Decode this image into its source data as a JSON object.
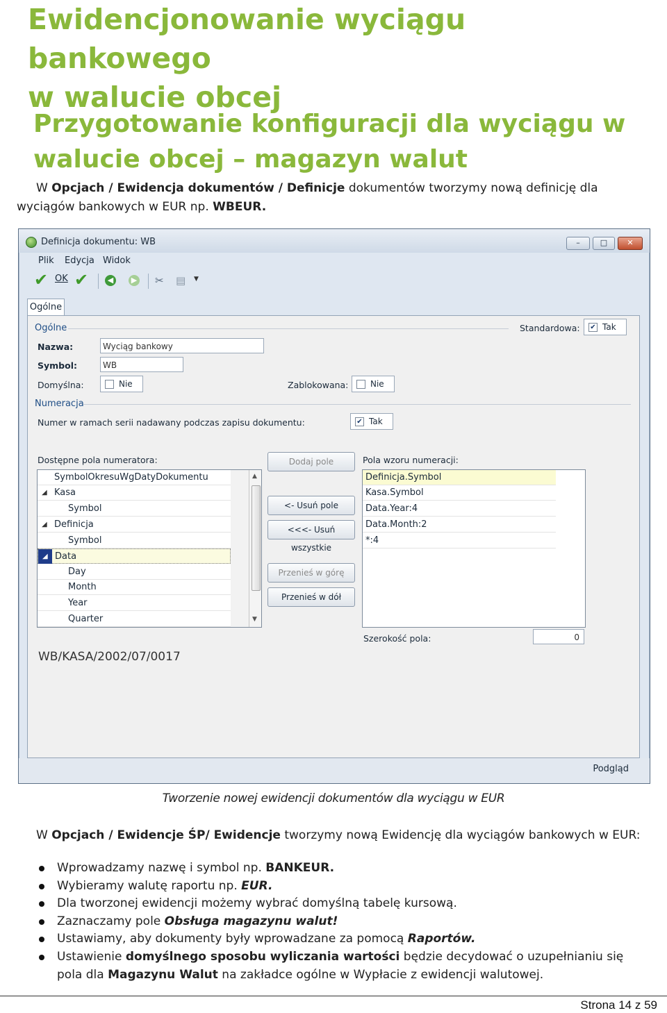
{
  "heading": {
    "line1": "Ewidencjonowanie wyciągu bankowego",
    "line2": "w walucie obcej"
  },
  "subheading": {
    "line1": "Przygotowanie konfiguracji dla wyciągu w",
    "line2": "walucie obcej – magazyn walut"
  },
  "para1": {
    "p0": "W ",
    "b0": "Opcjach / Ewidencja dokumentów / Definicje",
    "p1": " dokumentów tworzymy nową definicję dla wyciągów bankowych w EUR np. ",
    "b1": "WBEUR."
  },
  "window": {
    "title": "Definicja dokumentu: WB",
    "controls": {
      "minimize": "–",
      "maximize": "□",
      "close": "✕"
    },
    "menu": [
      "Plik",
      "Edycja",
      "Widok"
    ],
    "toolbar": {
      "ok_label": "OK"
    },
    "tab": "Ogólne",
    "group_general": "Ogólne",
    "standardowa_label": "Standardowa:",
    "standardowa_value": "Tak",
    "nazwa_label": "Nazwa:",
    "nazwa_value": "Wyciąg bankowy",
    "symbol_label": "Symbol:",
    "symbol_value": "WB",
    "domyslna_label": "Domyślna:",
    "domyslna_value": "Nie",
    "zablokowana_label": "Zablokowana:",
    "zablokowana_value": "Nie",
    "group_numeracja": "Numeracja",
    "numer_label": "Numer w ramach serii nadawany podczas zapisu dokumentu:",
    "numer_value": "Tak",
    "dostepne_label": "Dostępne pola numeratora:",
    "tree": [
      "SymbolOkresuWgDatyDokumentu",
      "Kasa",
      "Symbol",
      "Definicja",
      "Symbol",
      "Data",
      "Day",
      "Month",
      "Year",
      "Quarter"
    ],
    "buttons": {
      "dodaj": "Dodaj pole",
      "usun": "<- Usuń pole",
      "usun_wszystkie": "<<<- Usuń wszystkie",
      "gore": "Przenieś w górę",
      "dol": "Przenieś w dół"
    },
    "pola_label": "Pola wzoru numeracji:",
    "pola": [
      "Definicja.Symbol",
      "Kasa.Symbol",
      "Data.Year:4",
      "Data.Month:2",
      "*:4"
    ],
    "szerokosc_label": "Szerokość pola:",
    "szerokosc_value": "0",
    "preview": "WB/KASA/2002/07/0017",
    "podglad": "Podgląd"
  },
  "caption": "Tworzenie nowej ewidencji dokumentów dla wyciągu w EUR",
  "para2": {
    "p0": "W ",
    "b0": "Opcjach / Ewidencje ŚP/ Ewidencje",
    "p1": " tworzymy nową Ewidencję dla wyciągów bankowych w EUR:"
  },
  "bullets": {
    "b1_p0": "Wprowadzamy nazwę i symbol np. ",
    "b1_b0": "BANKEUR.",
    "b2_p0": "Wybieramy walutę raportu np. ",
    "b2_b0": "EUR.",
    "b3_p0": "Dla tworzonej ewidencji możemy wybrać domyślną tabelę kursową.",
    "b4_p0": "Zaznaczamy pole ",
    "b4_b0": "Obsługa magazynu walut!",
    "b5_p0": "Ustawiamy, aby dokumenty były wprowadzane za pomocą ",
    "b5_b0": "Raportów.",
    "b6_p0": "Ustawienie ",
    "b6_b0": "domyślnego sposobu wyliczania wartości",
    "b6_p1": " będzie decydować o uzupełnianiu się pola dla ",
    "b6_b1": "Magazynu Walut",
    "b6_p2": " na zakładce ogólne w Wypłacie z ewidencji walutowej."
  },
  "footer": "Strona 14 z 59"
}
